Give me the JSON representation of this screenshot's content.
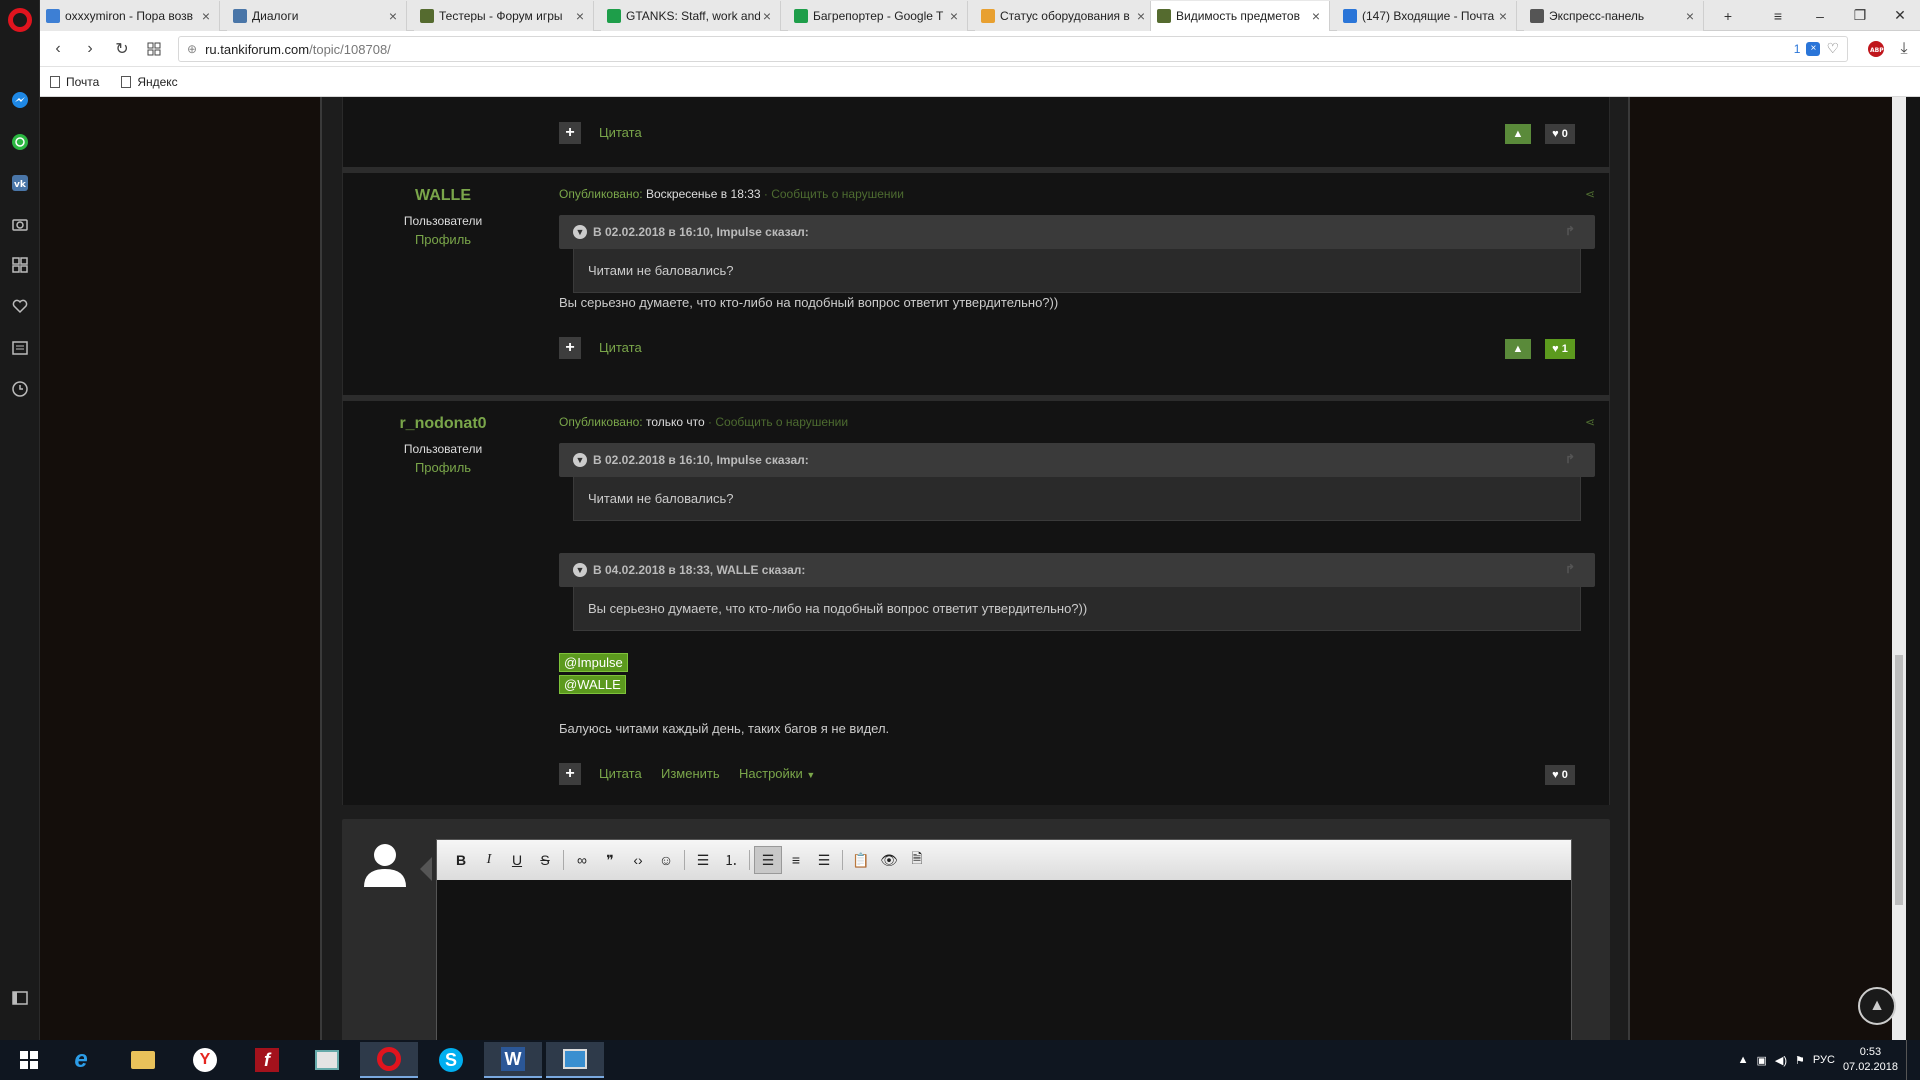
{
  "browser": {
    "tabs": [
      {
        "label": "oxxxymiron - Пора возв",
        "fav_color": "#3d7fd4"
      },
      {
        "label": "Диалоги",
        "fav_color": "#4a76a8"
      },
      {
        "label": "Тестеры - Форум игры",
        "fav_color": "#556b2f"
      },
      {
        "label": "GTANKS: Staff, work and",
        "fav_color": "#1e9e4a"
      },
      {
        "label": "Багрепортер - Google T",
        "fav_color": "#1e9e4a"
      },
      {
        "label": "Статус оборудования в",
        "fav_color": "#e8a030"
      },
      {
        "label": "Видимость предметов",
        "fav_color": "#556b2f"
      },
      {
        "label": "(147) Входящие - Почта",
        "fav_color": "#2a75d8"
      },
      {
        "label": "Экспресс-панель",
        "fav_color": "#555555"
      }
    ],
    "url_host": "ru.tankiforum.com",
    "url_path": "/topic/108708/",
    "url_badge": "1",
    "bookmarks": [
      "Почта",
      "Яндекс"
    ]
  },
  "posts": [
    {
      "author": "WALLE",
      "group": "Пользователи",
      "profile": "Профиль",
      "published_label": "Опубликовано:",
      "time": "Воскресенье в 18:33",
      "report": "· Сообщить о нарушении",
      "quotes": [
        {
          "head": "В 02.02.2018 в 16:10, Impulse сказал:",
          "body": "Читами не баловались?"
        }
      ],
      "text": "Вы серьезно думаете, что кто-либо на подобный вопрос ответит утвердительно?))",
      "quote_link": "Цитата",
      "likes": "1"
    },
    {
      "author": "r_nodonat0",
      "group": "Пользователи",
      "profile": "Профиль",
      "published_label": "Опубликовано:",
      "time": "только что",
      "report": "· Сообщить о нарушении",
      "quotes": [
        {
          "head": "В 02.02.2018 в 16:10, Impulse сказал:",
          "body": "Читами не баловались?"
        },
        {
          "head": "В 04.02.2018 в 18:33, WALLE сказал:",
          "body": "Вы серьезно думаете, что кто-либо на подобный вопрос ответит утвердительно?))"
        }
      ],
      "mentions": [
        "@Impulse",
        "@WALLE"
      ],
      "text": "Балуюсь читами каждый день, таких багов я не видел.",
      "quote_link": "Цитата",
      "edit_link": "Изменить",
      "settings_link": "Настройки",
      "likes": "0"
    }
  ],
  "prev_post": {
    "quote_link": "Цитата",
    "likes": "0"
  },
  "taskbar": {
    "lang": "РУС",
    "time": "0:53",
    "date": "07.02.2018"
  }
}
